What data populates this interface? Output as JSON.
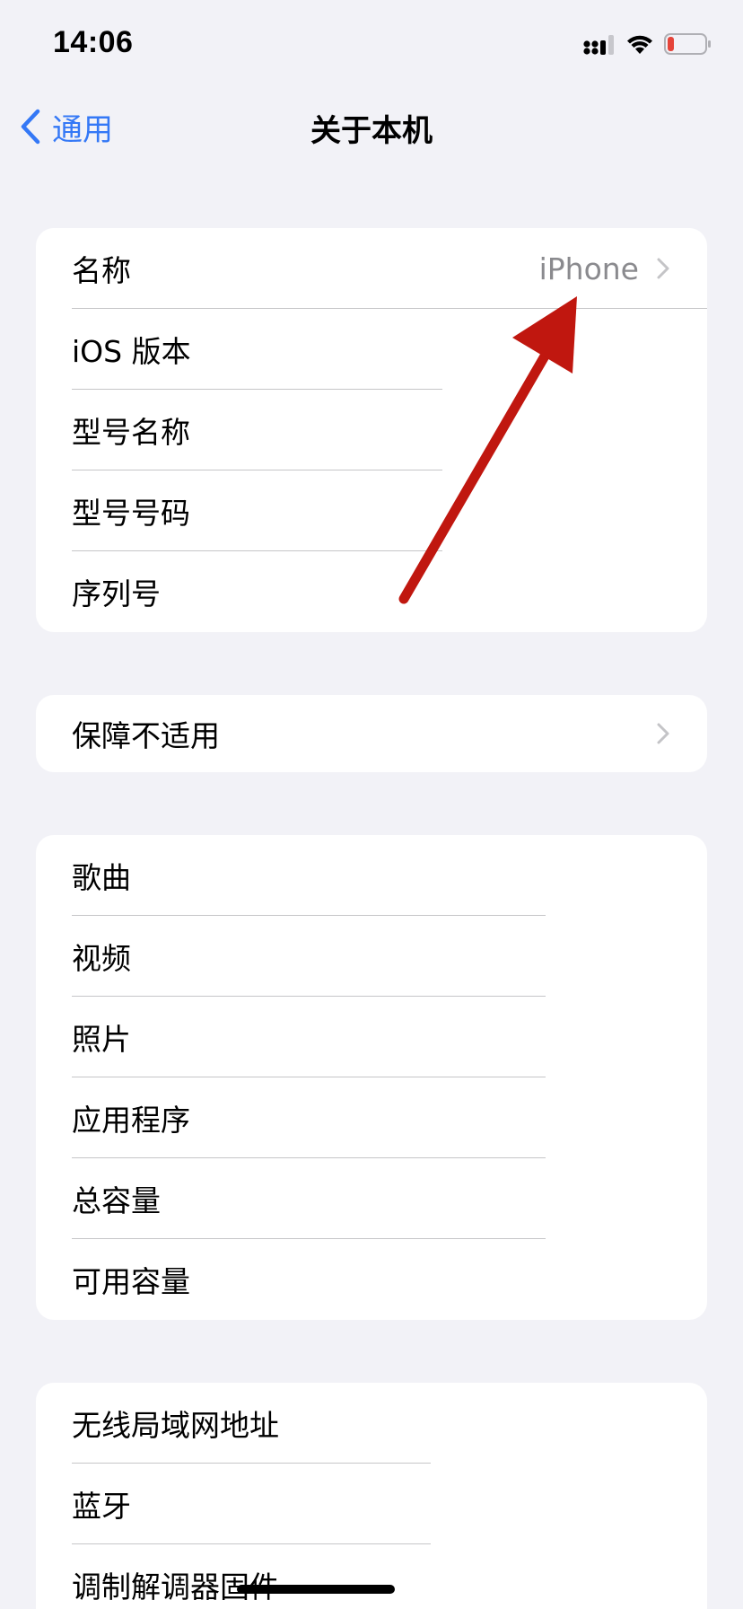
{
  "status_bar": {
    "time": "14:06",
    "signal_icon": "cellular-signal-icon",
    "wifi_icon": "wifi-icon",
    "battery_icon": "battery-low-icon",
    "battery_color": "#e5443a"
  },
  "nav": {
    "back_label": "通用",
    "title": "关于本机",
    "accent_color": "#3478f6"
  },
  "groups": {
    "device_info": [
      {
        "label": "名称",
        "value": "iPhone"
      },
      {
        "label": "iOS 版本"
      },
      {
        "label": "型号名称"
      },
      {
        "label": "型号号码"
      },
      {
        "label": "序列号"
      }
    ],
    "warranty": [
      {
        "label": "保障不适用"
      }
    ],
    "media": [
      {
        "label": "歌曲"
      },
      {
        "label": "视频"
      },
      {
        "label": "照片"
      },
      {
        "label": "应用程序"
      },
      {
        "label": "总容量"
      },
      {
        "label": "可用容量"
      }
    ],
    "network": [
      {
        "label": "无线局域网地址"
      },
      {
        "label": "蓝牙"
      },
      {
        "label": "调制解调器固件"
      }
    ]
  },
  "annotation": {
    "arrow_color": "#c0170f"
  }
}
